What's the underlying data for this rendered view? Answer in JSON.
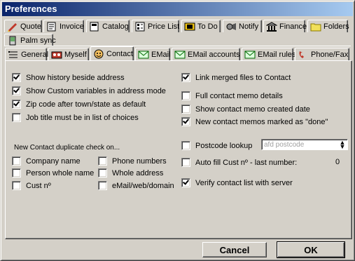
{
  "window": {
    "title": "Preferences"
  },
  "top_tabs": [
    {
      "label": "Quote",
      "icon": "pen-icon"
    },
    {
      "label": "Invoice",
      "icon": "invoice-icon"
    },
    {
      "label": "Catalog",
      "icon": "catalog-icon"
    },
    {
      "label": "Price List",
      "icon": "price-list-icon"
    },
    {
      "label": "To Do",
      "icon": "todo-icon"
    },
    {
      "label": "Notify",
      "icon": "notify-icon"
    },
    {
      "label": "Finance",
      "icon": "bank-icon"
    },
    {
      "label": "Folders",
      "icon": "folder-icon"
    },
    {
      "label": "Palm sync",
      "icon": "palm-icon"
    }
  ],
  "sub_tabs": [
    {
      "label": "General",
      "icon": "list-icon"
    },
    {
      "label": "Myself",
      "icon": "myself-icon"
    },
    {
      "label": "Contact",
      "icon": "contact-icon",
      "active": true
    },
    {
      "label": "EMail",
      "icon": "email-icon"
    },
    {
      "label": "EMail accounts",
      "icon": "email-accounts-icon"
    },
    {
      "label": "EMail rules",
      "icon": "email-rules-icon"
    },
    {
      "label": "Phone/Fax",
      "icon": "phone-icon"
    }
  ],
  "left_options": [
    {
      "label": "Show history beside address",
      "checked": true
    },
    {
      "label": "Show Custom variables in address mode",
      "checked": true
    },
    {
      "label": "Zip code after town/state as default",
      "checked": true
    },
    {
      "label": "Job title must be in list of choices",
      "checked": false
    }
  ],
  "right_options": [
    {
      "label": "Link merged files to Contact",
      "checked": true
    },
    {
      "label": "Full contact memo details",
      "checked": false
    },
    {
      "label": "Show contact memo created date",
      "checked": false
    },
    {
      "label": "New contact memos marked as \"done\"",
      "checked": true
    }
  ],
  "duplicate_check": {
    "heading": "New Contact duplicate check on...",
    "col1": [
      {
        "label": "Company name",
        "checked": false
      },
      {
        "label": "Person whole name",
        "checked": false
      },
      {
        "label": "Cust nº",
        "checked": false
      }
    ],
    "col2": [
      {
        "label": "Phone numbers",
        "checked": false
      },
      {
        "label": "Whole address",
        "checked": false
      },
      {
        "label": "eMail/web/domain",
        "checked": false
      }
    ]
  },
  "postcode": {
    "label": "Postcode lookup",
    "checked": false,
    "combo_value": "afd postcode"
  },
  "autofill": {
    "label": "Auto fill Cust nº - last number:",
    "checked": false,
    "value": "0"
  },
  "verify": {
    "label": "Verify contact list with server",
    "checked": true
  },
  "buttons": {
    "cancel": "Cancel",
    "ok": "OK"
  }
}
